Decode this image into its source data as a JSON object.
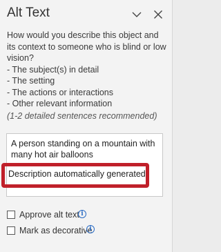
{
  "pane": {
    "title": "Alt Text",
    "collapse_icon": "chevron-down-icon",
    "close_icon": "close-icon"
  },
  "instructions": {
    "question": "How would you describe this object and its context to someone who is blind or low vision?",
    "items": [
      "- The subject(s) in detail",
      "- The setting",
      "- The actions or interactions",
      "- Other relevant information"
    ],
    "recommendation": "(1-2 detailed sentences recommended)"
  },
  "alt_text": {
    "description": "A person standing on a mountain with many hot air balloons",
    "generated_note": "Description automatically generated"
  },
  "options": {
    "approve_label": "Approve alt text",
    "approve_checked": false,
    "decorative_label": "Mark as decorative",
    "decorative_checked": false,
    "info_icon": "info-icon"
  },
  "colors": {
    "highlight": "#c0202a",
    "info": "#2b6cc4"
  }
}
